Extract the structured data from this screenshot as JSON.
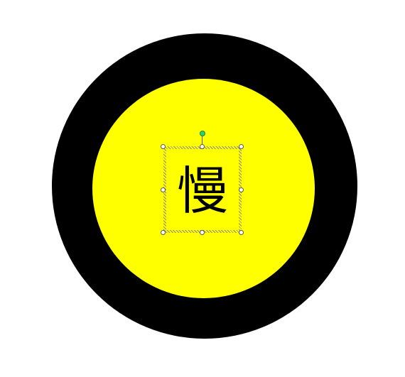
{
  "shape": {
    "outer_color": "#000000",
    "inner_color": "#ffff00"
  },
  "textbox": {
    "text": "慢",
    "text_color": "#000000",
    "selected": true
  },
  "handles": {
    "resize": [
      "top-left",
      "top-center",
      "top-right",
      "middle-left",
      "middle-right",
      "bottom-left",
      "bottom-center",
      "bottom-right"
    ],
    "rotate_color": "#2fd36f",
    "rotate_icon": "rotate-handle-icon"
  }
}
